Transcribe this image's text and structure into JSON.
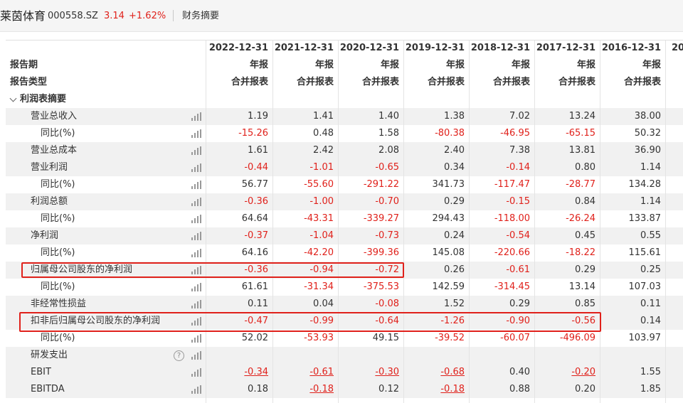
{
  "header": {
    "company_name": "莱茵体育",
    "stock_code": "000558.SZ",
    "price": "3.14",
    "change": "+1.62%",
    "tab_label": "财务摘要"
  },
  "table": {
    "columns": [
      {
        "date": "2022-12-31",
        "report": "年报",
        "type": "合并报表"
      },
      {
        "date": "2021-12-31",
        "report": "年报",
        "type": "合并报表"
      },
      {
        "date": "2020-12-31",
        "report": "年报",
        "type": "合并报表"
      },
      {
        "date": "2019-12-31",
        "report": "年报",
        "type": "合并报表"
      },
      {
        "date": "2018-12-31",
        "report": "年报",
        "type": "合并报表"
      },
      {
        "date": "2017-12-31",
        "report": "年报",
        "type": "合并报表"
      },
      {
        "date": "2016-12-31",
        "report": "年报",
        "type": "合并报表"
      },
      {
        "date": "20",
        "report": "",
        "type": ""
      }
    ],
    "header_labels": {
      "period": "报告期",
      "report_type": "报告类型"
    },
    "section_title": "利润表摘要",
    "rows": [
      {
        "label": "营业总收入",
        "indent": 1,
        "values": [
          "1.19",
          "1.41",
          "1.40",
          "1.38",
          "7.02",
          "13.24",
          "38.00"
        ]
      },
      {
        "label": "同比(%)",
        "indent": 2,
        "values": [
          "-15.26",
          "0.48",
          "1.58",
          "-80.38",
          "-46.95",
          "-65.15",
          "50.32"
        ]
      },
      {
        "label": "营业总成本",
        "indent": 1,
        "values": [
          "1.61",
          "2.42",
          "2.08",
          "2.40",
          "7.38",
          "13.81",
          "36.90"
        ]
      },
      {
        "label": "营业利润",
        "indent": 1,
        "values": [
          "-0.44",
          "-1.01",
          "-0.65",
          "0.34",
          "-0.14",
          "0.80",
          "1.14"
        ]
      },
      {
        "label": "同比(%)",
        "indent": 2,
        "values": [
          "56.77",
          "-55.60",
          "-291.22",
          "341.73",
          "-117.47",
          "-28.77",
          "134.28"
        ]
      },
      {
        "label": "利润总额",
        "indent": 1,
        "values": [
          "-0.36",
          "-1.00",
          "-0.70",
          "0.29",
          "-0.15",
          "0.84",
          "1.14"
        ]
      },
      {
        "label": "同比(%)",
        "indent": 2,
        "values": [
          "64.64",
          "-43.31",
          "-339.27",
          "294.43",
          "-118.00",
          "-26.24",
          "133.87"
        ]
      },
      {
        "label": "净利润",
        "indent": 1,
        "values": [
          "-0.37",
          "-1.04",
          "-0.73",
          "0.24",
          "-0.54",
          "0.45",
          "0.55"
        ]
      },
      {
        "label": "同比(%)",
        "indent": 2,
        "values": [
          "64.16",
          "-42.20",
          "-399.36",
          "145.08",
          "-220.66",
          "-18.22",
          "115.61"
        ]
      },
      {
        "label": "归属母公司股东的净利润",
        "indent": 1,
        "values": [
          "-0.36",
          "-0.94",
          "-0.72",
          "0.26",
          "-0.61",
          "0.29",
          "0.25"
        ]
      },
      {
        "label": "同比(%)",
        "indent": 2,
        "values": [
          "61.61",
          "-31.34",
          "-375.53",
          "142.59",
          "-314.45",
          "13.14",
          "107.03"
        ]
      },
      {
        "label": "非经常性损益",
        "indent": 1,
        "values": [
          "0.11",
          "0.04",
          "-0.08",
          "1.52",
          "0.29",
          "0.85",
          "0.11"
        ]
      },
      {
        "label": "扣非后归属母公司股东的净利润",
        "indent": 1,
        "values": [
          "-0.47",
          "-0.99",
          "-0.64",
          "-1.26",
          "-0.90",
          "-0.56",
          "0.14"
        ]
      },
      {
        "label": "同比(%)",
        "indent": 2,
        "values": [
          "52.02",
          "-53.93",
          "49.15",
          "-39.52",
          "-60.07",
          "-496.09",
          "103.97"
        ]
      },
      {
        "label": "研发支出",
        "indent": 1,
        "help": true,
        "values": [
          "",
          "",
          "",
          "",
          "",
          "",
          ""
        ]
      },
      {
        "label": "EBIT",
        "indent": 1,
        "underline": true,
        "values": [
          "-0.34",
          "-0.61",
          "-0.30",
          "-0.68",
          "0.40",
          "-0.20",
          "1.55"
        ]
      },
      {
        "label": "EBITDA",
        "indent": 1,
        "underline": true,
        "values": [
          "0.18",
          "-0.18",
          "0.12",
          "-0.18",
          "0.88",
          "0.20",
          "1.85"
        ]
      }
    ]
  },
  "colors": {
    "negative": "#e0211b",
    "highlight_box": "#e0211b",
    "row_alt": "#f1f1f1"
  }
}
